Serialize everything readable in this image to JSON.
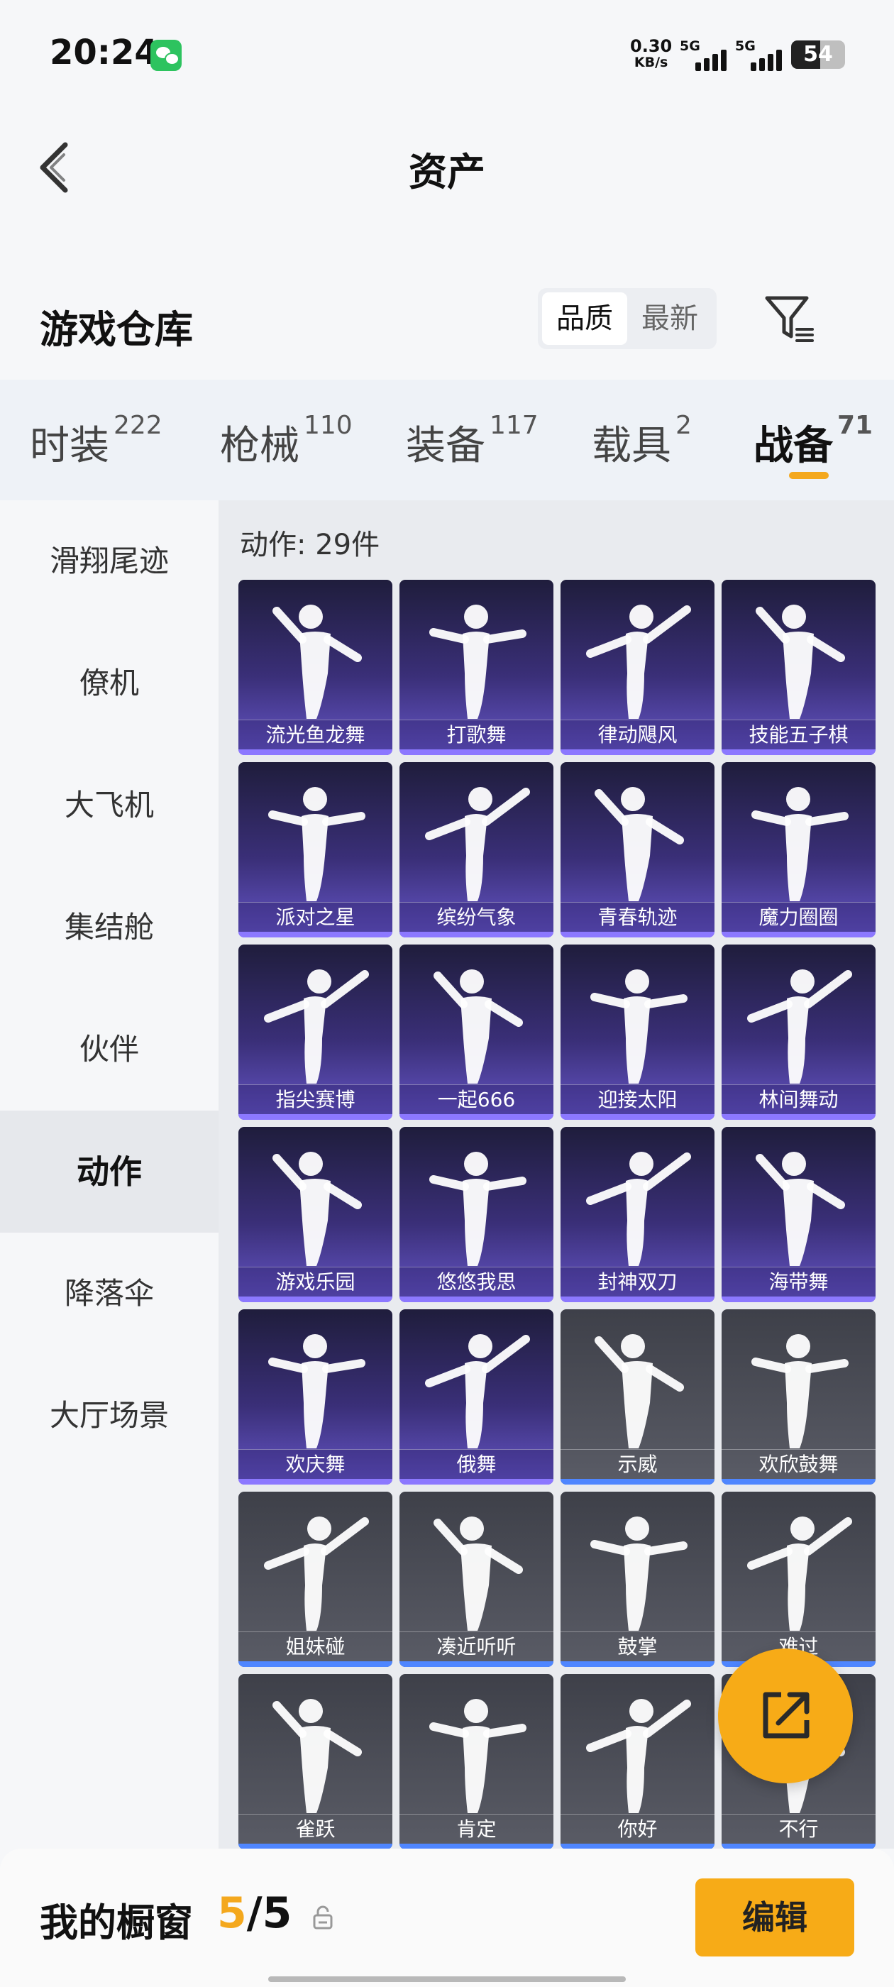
{
  "status_bar": {
    "time": "20:24",
    "net_speed_value": "0.30",
    "net_speed_unit": "KB/s",
    "signal1_label": "5G",
    "signal2_label": "5G",
    "battery_level": "54",
    "battery_fraction": 0.54
  },
  "header": {
    "title": "资产"
  },
  "section": {
    "title": "游戏仓库",
    "sort_options": [
      "品质",
      "最新"
    ],
    "active_sort": "品质"
  },
  "tabs": [
    {
      "label": "时装",
      "count": "222",
      "active": false
    },
    {
      "label": "枪械",
      "count": "110",
      "active": false
    },
    {
      "label": "装备",
      "count": "117",
      "active": false
    },
    {
      "label": "载具",
      "count": "2",
      "active": false
    },
    {
      "label": "战备",
      "count": "71",
      "active": true
    }
  ],
  "sidebar": {
    "items": [
      "滑翔尾迹",
      "僚机",
      "大飞机",
      "集结舱",
      "伙伴",
      "动作",
      "降落伞",
      "大厅场景"
    ],
    "active_index": 5
  },
  "content": {
    "count_label": "动作: 29件",
    "items": [
      {
        "name": "流光鱼龙舞",
        "style": "purple"
      },
      {
        "name": "打歌舞",
        "style": "purple"
      },
      {
        "name": "律动飓风",
        "style": "purple"
      },
      {
        "name": "技能五子棋",
        "style": "purple"
      },
      {
        "name": "派对之星",
        "style": "purple"
      },
      {
        "name": "缤纷气象",
        "style": "purple"
      },
      {
        "name": "青春轨迹",
        "style": "purple"
      },
      {
        "name": "魔力圈圈",
        "style": "purple"
      },
      {
        "name": "指尖赛博",
        "style": "purple"
      },
      {
        "name": "一起666",
        "style": "purple"
      },
      {
        "name": "迎接太阳",
        "style": "purple"
      },
      {
        "name": "林间舞动",
        "style": "purple"
      },
      {
        "name": "游戏乐园",
        "style": "purple"
      },
      {
        "name": "悠悠我思",
        "style": "purple"
      },
      {
        "name": "封神双刀",
        "style": "purple"
      },
      {
        "name": "海带舞",
        "style": "purple"
      },
      {
        "name": "欢庆舞",
        "style": "purple"
      },
      {
        "name": "俄舞",
        "style": "purple"
      },
      {
        "name": "示威",
        "style": "grey"
      },
      {
        "name": "欢欣鼓舞",
        "style": "grey"
      },
      {
        "name": "姐妹碰",
        "style": "grey"
      },
      {
        "name": "凑近听听",
        "style": "grey"
      },
      {
        "name": "鼓掌",
        "style": "grey"
      },
      {
        "name": "难过",
        "style": "grey"
      },
      {
        "name": "雀跃",
        "style": "grey"
      },
      {
        "name": "肯定",
        "style": "grey"
      },
      {
        "name": "你好",
        "style": "grey"
      },
      {
        "name": "不行",
        "style": "grey"
      }
    ]
  },
  "bottom_bar": {
    "window_label": "我的橱窗",
    "window_current": "5",
    "window_separator": "/",
    "window_total": "5",
    "edit_label": "编辑"
  },
  "colors": {
    "accent": "#f4a81d",
    "card_purple": "#3a2f78",
    "card_grey": "#4e5059"
  }
}
